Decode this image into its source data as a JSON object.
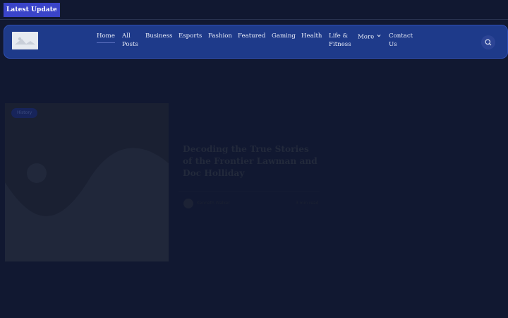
{
  "topbar": {
    "latest_label": "Latest Update"
  },
  "nav": {
    "logo_icon": "image-placeholder-icon",
    "items": [
      {
        "label": "Home",
        "active": true
      },
      {
        "label": "All Posts"
      },
      {
        "label": "Business"
      },
      {
        "label": "Esports"
      },
      {
        "label": "Fashion"
      },
      {
        "label": "Featured"
      },
      {
        "label": "Gaming"
      },
      {
        "label": "Health"
      },
      {
        "label": "Life & Fitness"
      },
      {
        "label": "More"
      },
      {
        "label": "Contact Us"
      }
    ],
    "more_icon": "chevron-down-icon",
    "search_icon": "search-icon"
  },
  "featured": {
    "category": "History",
    "title": "Decoding the True Stories of the Frontier Lawman and Doc Holliday",
    "author": "Kenneth Walker",
    "read_time": "3 min read"
  },
  "colors": {
    "background": "#111831",
    "navbar": "#1e3a8a",
    "badge": "#3a44c9",
    "nav_text": "#e8ecf8"
  }
}
